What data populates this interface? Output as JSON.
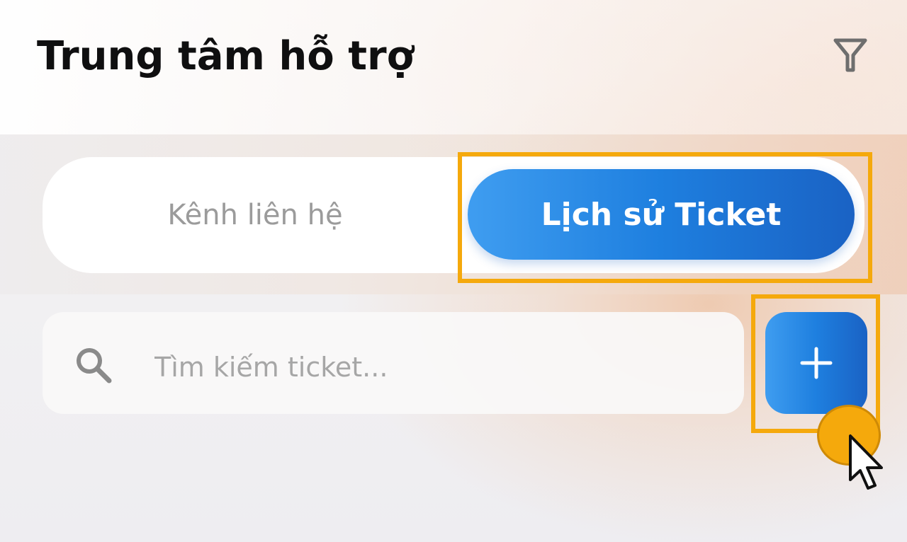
{
  "header": {
    "title": "Trung tâm hỗ trợ",
    "filter_icon": "filter-funnel-icon"
  },
  "tabs": {
    "contact_label": "Kênh liên hệ",
    "history_label": "Lịch sử Ticket",
    "active": "history"
  },
  "search": {
    "placeholder": "Tìm kiếm ticket...",
    "value": "",
    "icon": "search-icon"
  },
  "add_button": {
    "label": "+",
    "icon": "plus-icon"
  },
  "colors": {
    "accent_start": "#3f9df0",
    "accent_end": "#1a62c4",
    "highlight": "#f5a90c",
    "title_text": "#0f0f10",
    "muted_text": "#9b9b9b"
  }
}
